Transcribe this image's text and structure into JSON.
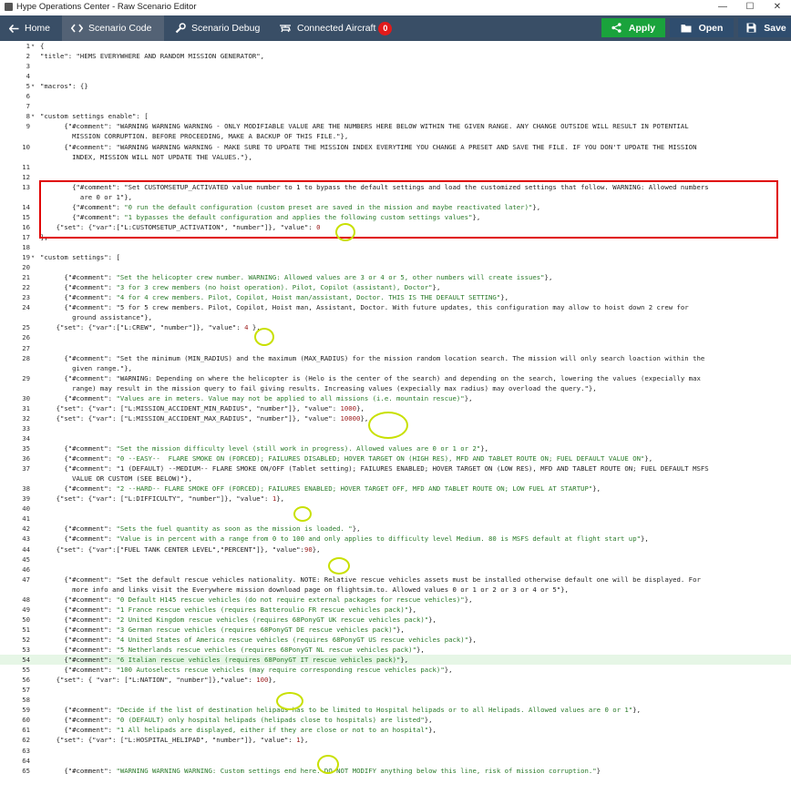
{
  "window": {
    "title": "Hype Operations Center - Raw Scenario Editor",
    "min": "—",
    "max": "☐",
    "close": "✕"
  },
  "toolbar": {
    "home": "Home",
    "scenario_code": "Scenario Code",
    "scenario_debug": "Scenario Debug",
    "connected_aircraft": "Connected Aircraft",
    "connected_count": "0",
    "apply": "Apply",
    "open": "Open",
    "save": "Save",
    "colors": {
      "bar": "#394e66",
      "active": "#536275",
      "apply": "#1aa33c",
      "open": "#2f4d6e",
      "save": "#2f4d6e"
    }
  },
  "editor": {
    "lines": [
      {
        "n": "1",
        "fold": true,
        "text": "{"
      },
      {
        "n": "2",
        "text": "\"title\": \"HEMS EVERYWHERE AND RANDOM MISSION GENERATOR\","
      },
      {
        "n": "3",
        "text": ""
      },
      {
        "n": "4",
        "text": ""
      },
      {
        "n": "5",
        "fold": true,
        "text": "\"macros\": {}"
      },
      {
        "n": "6",
        "text": ""
      },
      {
        "n": "7",
        "text": ""
      },
      {
        "n": "8",
        "fold": true,
        "text": "\"custom settings enable\": ["
      },
      {
        "n": "9",
        "text": "      {\"#comment\": \"WARNING WARNING WARNING - ONLY MODIFIABLE VALUE ARE THE NUMBERS HERE BELOW WITHIN THE GIVEN RANGE. ANY CHANGE OUTSIDE WILL RESULT IN POTENTIAL"
      },
      {
        "n": "",
        "text": "        MISSION CORRUPTION. BEFORE PROCEEDING, MAKE A BACKUP OF THIS FILE.\"},"
      },
      {
        "n": "10",
        "text": "      {\"#comment\": \"WARNING WARNING WARNING - MAKE SURE TO UPDATE THE MISSION INDEX EVERYTIME YOU CHANGE A PRESET AND SAVE THE FILE. IF YOU DON'T UPDATE THE MISSION"
      },
      {
        "n": "",
        "text": "        INDEX, MISSION WILL NOT UPDATE THE VALUES.\"},"
      },
      {
        "n": "11",
        "text": ""
      },
      {
        "n": "12",
        "text": ""
      },
      {
        "n": "13",
        "text": "        {\"#comment\": \"Set CUSTOMSETUP_ACTIVATED value number to 1 to bypass the default settings and load the customized settings that follow. WARNING: Allowed numbers"
      },
      {
        "n": "",
        "text": "          are 0 or 1\"},"
      },
      {
        "n": "14",
        "text": "        {\"#comment\": \"0 run the default configuration (custom preset are saved in the mission and maybe reactivated later)\"},"
      },
      {
        "n": "15",
        "text": "        {\"#comment\": \"1 bypasses the default configuration and applies the following custom settings values\"},"
      },
      {
        "n": "16",
        "text": "    {\"set\": {\"var\":[\"L:CUSTOMSETUP_ACTIVATION\", \"number\"]}, \"value\": 0"
      },
      {
        "n": "17",
        "text": "],"
      },
      {
        "n": "18",
        "text": ""
      },
      {
        "n": "19",
        "fold": true,
        "text": "\"custom settings\": ["
      },
      {
        "n": "20",
        "text": ""
      },
      {
        "n": "21",
        "text": "      {\"#comment\": \"Set the helicopter crew number. WARNING: Allowed values are 3 or 4 or 5, other numbers will create issues\"},"
      },
      {
        "n": "22",
        "text": "      {\"#comment\": \"3 for 3 crew members (no hoist operation). Pilot, Copilot (assistant), Doctor\"},"
      },
      {
        "n": "23",
        "text": "      {\"#comment\": \"4 for 4 crew members. Pilot, Copilot, Hoist man/assistant, Doctor. THIS IS THE DEFAULT SETTING\"},"
      },
      {
        "n": "24",
        "text": "      {\"#comment\": \"5 for 5 crew members. Pilot, Copilot, Hoist man, Assistant, Doctor. With future updates, this configuration may allow to hoist down 2 crew for"
      },
      {
        "n": "",
        "text": "        ground assistance\"},"
      },
      {
        "n": "25",
        "text": "    {\"set\": {\"var\":[\"L:CREW\", \"number\"]}, \"value\": 4 },"
      },
      {
        "n": "26",
        "text": ""
      },
      {
        "n": "27",
        "text": ""
      },
      {
        "n": "28",
        "text": "      {\"#comment\": \"Set the minimum (MIN_RADIUS) and the maximum (MAX_RADIUS) for the mission random location search. The mission will only search loaction within the"
      },
      {
        "n": "",
        "text": "        given range.\"},"
      },
      {
        "n": "29",
        "text": "      {\"#comment\": \"WARNING: Depending on where the helicopter is (Helo is the center of the search) and depending on the search, lowering the values (expecially max"
      },
      {
        "n": "",
        "text": "        range) may result in the mission query to fail giving results. Increasing values (expecially max radius) may overload the query.\"},"
      },
      {
        "n": "30",
        "text": "      {\"#comment\": \"Values are in meters. Value may not be applied to all missions (i.e. mountain rescue)\"},"
      },
      {
        "n": "31",
        "text": "    {\"set\": {\"var\": [\"L:MISSION_ACCIDENT_MIN_RADIUS\", \"number\"]}, \"value\": 1000},"
      },
      {
        "n": "32",
        "text": "    {\"set\": {\"var\": [\"L:MISSION_ACCIDENT_MAX_RADIUS\", \"number\"]}, \"value\": 10000},"
      },
      {
        "n": "33",
        "text": ""
      },
      {
        "n": "34",
        "text": ""
      },
      {
        "n": "35",
        "text": "      {\"#comment\": \"Set the mission difficulty level (still work in progress). Allowed values are 0 or 1 or 2\"},"
      },
      {
        "n": "36",
        "text": "      {\"#comment\": \"0 --EASY--  FLARE SMOKE ON (FORCED); FAILURES DISABLED; HOVER TARGET ON (HIGH RES), MFD AND TABLET ROUTE ON; FUEL DEFAULT VALUE ON\"},"
      },
      {
        "n": "37",
        "text": "      {\"#comment\": \"1 (DEFAULT) --MEDIUM-- FLARE SMOKE ON/OFF (Tablet setting); FAILURES ENABLED; HOVER TARGET ON (LOW RES), MFD AND TABLET ROUTE ON; FUEL DEFAULT MSFS"
      },
      {
        "n": "",
        "text": "        VALUE OR CUSTOM (SEE BELOW)\"},"
      },
      {
        "n": "38",
        "text": "      {\"#comment\": \"2 --HARD-- FLARE SMOKE OFF (FORCED); FAILURES ENABLED; HOVER TARGET OFF, MFD AND TABLET ROUTE ON; LOW FUEL AT STARTUP\"},"
      },
      {
        "n": "39",
        "text": "    {\"set\": {\"var\": [\"L:DIFFICULTY\", \"number\"]}, \"value\": 1},"
      },
      {
        "n": "40",
        "text": ""
      },
      {
        "n": "41",
        "text": ""
      },
      {
        "n": "42",
        "text": "      {\"#comment\": \"Sets the fuel quantity as soon as the mission is loaded. \"},"
      },
      {
        "n": "43",
        "text": "      {\"#comment\": \"Value is in percent with a range from 0 to 100 and only applies to difficulty level Medium. 80 is MSFS default at flight start up\"},"
      },
      {
        "n": "44",
        "text": "    {\"set\": {\"var\":[\"FUEL TANK CENTER LEVEL\",\"PERCENT\"]}, \"value\":90},"
      },
      {
        "n": "45",
        "text": ""
      },
      {
        "n": "46",
        "text": ""
      },
      {
        "n": "47",
        "text": "      {\"#comment\": \"Set the default rescue vehicles nationality. NOTE: Relative rescue vehicles assets must be installed otherwise default one will be displayed. For"
      },
      {
        "n": "",
        "text": "        more info and links visit the Everywhere mission download page on flightsim.to. Allowed values 0 or 1 or 2 or 3 or 4 or 5\"},"
      },
      {
        "n": "48",
        "text": "      {\"#comment\": \"0 Default H145 rescue vehicles (do not require external packages for rescue vehicles)\"},"
      },
      {
        "n": "49",
        "text": "      {\"#comment\": \"1 France rescue vehicles (requires Batteroulio FR rescue vehicles pack)\"},"
      },
      {
        "n": "50",
        "text": "      {\"#comment\": \"2 United Kingdom rescue vehicles (requires 68PonyGT UK rescue vehicles pack)\"},"
      },
      {
        "n": "51",
        "text": "      {\"#comment\": \"3 German rescue vehicles (requires 68PonyGT DE rescue vehicles pack)\"},"
      },
      {
        "n": "52",
        "text": "      {\"#comment\": \"4 United States of America rescue vehicles (requires 68PonyGT US rescue vehicles pack)\"},"
      },
      {
        "n": "53",
        "text": "      {\"#comment\": \"5 Netherlands rescue vehicles (requires 68PonyGT NL rescue vehicles pack)\"},"
      },
      {
        "n": "54",
        "hl": true,
        "text": "      {\"#comment\": \"6 Italian rescue vehicles (requires 68PonyGT IT rescue vehicles pack)\"},"
      },
      {
        "n": "55",
        "text": "      {\"#comment\": \"100 Autoselects rescue vehicles (may require corresponding rescue vehicles pack)\"},"
      },
      {
        "n": "56",
        "text": "    {\"set\": { \"var\": [\"L:NATION\", \"number\"]},\"value\": 100},"
      },
      {
        "n": "57",
        "text": ""
      },
      {
        "n": "58",
        "text": ""
      },
      {
        "n": "59",
        "text": "      {\"#comment\": \"Decide if the list of destination helipads has to be limited to Hospital helipads or to all Helipads. Allowed values are 0 or 1\"},"
      },
      {
        "n": "60",
        "text": "      {\"#comment\": \"0 (DEFAULT) only hospital helipads (helipads close to hospitals) are listed\"},"
      },
      {
        "n": "61",
        "text": "      {\"#comment\": \"1 All helipads are displayed, either if they are close or not to an hospital\"},"
      },
      {
        "n": "62",
        "text": "    {\"set\": {\"var\": [\"L:HOSPITAL_HELIPAD\", \"number\"]}, \"value\": 1},"
      },
      {
        "n": "63",
        "text": ""
      },
      {
        "n": "64",
        "text": ""
      },
      {
        "n": "65",
        "text": "      {\"#comment\": \"WARNING WARNING WARNING: Custom settings end here. DO NOT MODIFY anything below this line, risk of mission corruption.\"}"
      }
    ]
  }
}
